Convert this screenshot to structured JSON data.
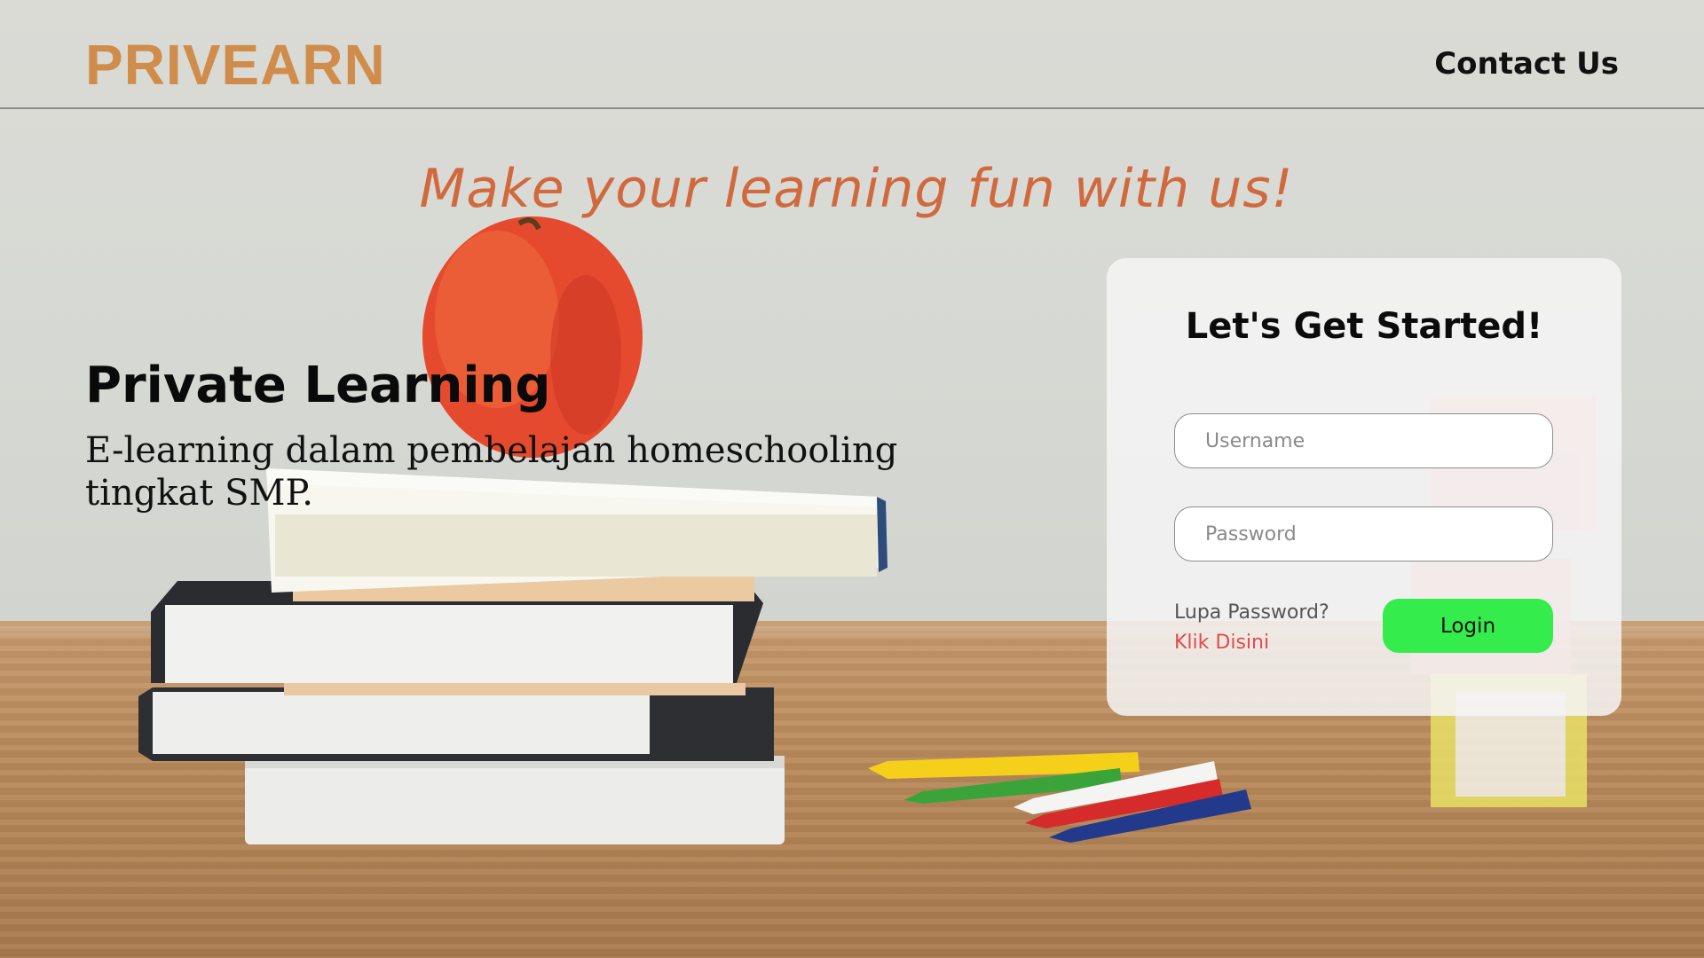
{
  "header": {
    "logo_text": "PRIVEARN",
    "contact_label": "Contact Us"
  },
  "hero": {
    "tagline": "Make your learning fun with us!",
    "title": "Private Learning",
    "subtitle": "E-learning dalam pembelajan homeschooling tingkat SMP."
  },
  "login": {
    "title": "Let's Get Started!",
    "username_placeholder": "Username",
    "username_value": "",
    "password_placeholder": "Password",
    "password_value": "",
    "forgot_label": "Lupa Password?",
    "forgot_link": "Klik Disini",
    "login_button": "Login"
  },
  "colors": {
    "brand": "#d08c4a",
    "tagline": "#d06a3e",
    "login_button": "#34ec4b",
    "link": "#e24b4b"
  }
}
